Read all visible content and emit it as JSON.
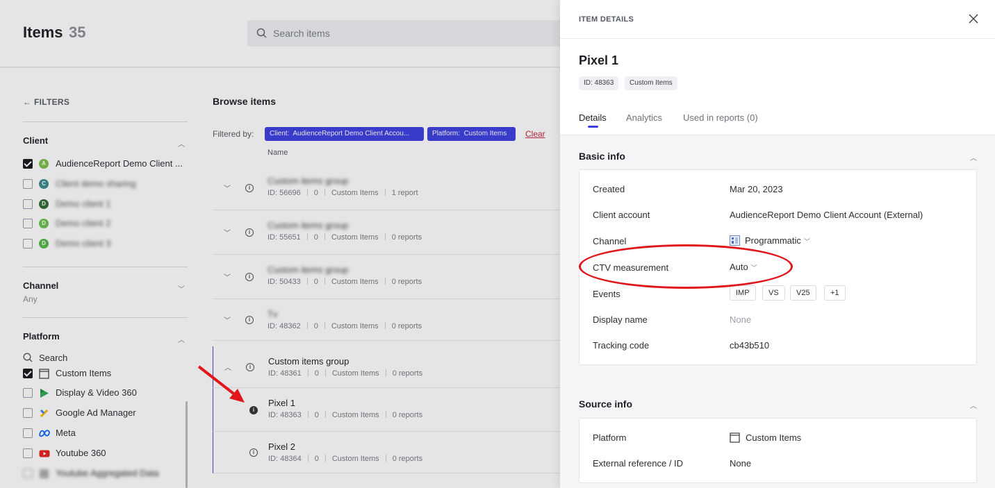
{
  "header": {
    "title": "Items",
    "count": "35",
    "search_placeholder": "Search items"
  },
  "sidebar": {
    "filters_label": "FILTERS",
    "client": {
      "title": "Client",
      "options": [
        {
          "label": "AudienceReport Demo Client ...",
          "avatar": "A",
          "color": "#7cc04a",
          "checked": true
        },
        {
          "label": "Client demo sharing",
          "avatar": "C",
          "color": "#3a8a8c",
          "checked": false
        },
        {
          "label": "Demo client 1",
          "avatar": "D",
          "color": "#2f6d2f",
          "checked": false
        },
        {
          "label": "Demo client 2",
          "avatar": "D",
          "color": "#6ac24a",
          "checked": false
        },
        {
          "label": "Demo client 3",
          "avatar": "D",
          "color": "#55b947",
          "checked": false
        }
      ]
    },
    "channel": {
      "title": "Channel",
      "value": "Any"
    },
    "platform": {
      "title": "Platform",
      "search_placeholder": "Search",
      "options": [
        {
          "label": "Custom Items",
          "icon": "custom-items-icon",
          "checked": true
        },
        {
          "label": "Display & Video 360",
          "icon": "dv360-icon",
          "checked": false
        },
        {
          "label": "Google Ad Manager",
          "icon": "google-ad-manager-icon",
          "checked": false
        },
        {
          "label": "Meta",
          "icon": "meta-icon",
          "checked": false
        },
        {
          "label": "Youtube 360",
          "icon": "youtube-icon",
          "checked": false
        },
        {
          "label": "Youtube Aggregated Data",
          "icon": "youtube-aggregated-icon",
          "checked": false
        }
      ]
    }
  },
  "main": {
    "title": "Browse items",
    "filtered_by_label": "Filtered by:",
    "chips": [
      {
        "key": "Client:",
        "value": "AudienceReport Demo Client Accou..."
      },
      {
        "key": "Platform:",
        "value": "Custom Items"
      }
    ],
    "clear_label": "Clear",
    "column_name": "Name",
    "rows": [
      {
        "name": "Custom items group",
        "id": "ID: 56696",
        "count": "0",
        "type": "Custom Items",
        "reports": "1 report",
        "blurred": true
      },
      {
        "name": "Custom items group",
        "id": "ID: 55651",
        "count": "0",
        "type": "Custom Items",
        "reports": "0 reports",
        "blurred": true
      },
      {
        "name": "Custom items group",
        "id": "ID: 50433",
        "count": "0",
        "type": "Custom Items",
        "reports": "0 reports",
        "blurred": true
      },
      {
        "name": "Tv",
        "id": "ID: 48362",
        "count": "0",
        "type": "Custom Items",
        "reports": "0 reports",
        "blurred": true
      },
      {
        "name": "Custom items group",
        "id": "ID: 48361",
        "count": "0",
        "type": "Custom Items",
        "reports": "0 reports",
        "blurred": false
      },
      {
        "name": "Pixel 1",
        "id": "ID: 48363",
        "count": "0",
        "type": "Custom Items",
        "reports": "0 reports",
        "blurred": false
      },
      {
        "name": "Pixel 2",
        "id": "ID: 48364",
        "count": "0",
        "type": "Custom Items",
        "reports": "0 reports",
        "blurred": false
      }
    ]
  },
  "panel": {
    "title": "ITEM DETAILS",
    "item_name": "Pixel 1",
    "tags": [
      "ID: 48363",
      "Custom Items"
    ],
    "tabs": [
      "Details",
      "Analytics",
      "Used in reports (0)"
    ],
    "basic_info": {
      "title": "Basic info",
      "fields": {
        "created_label": "Created",
        "created_value": "Mar 20, 2023",
        "client_label": "Client account",
        "client_value": "AudienceReport Demo Client Account (External)",
        "channel_label": "Channel",
        "channel_value": "Programmatic",
        "ctv_label": "CTV measurement",
        "ctv_value": "Auto",
        "events_label": "Events",
        "events": [
          "IMP",
          "VS",
          "V25",
          "+1"
        ],
        "display_label": "Display name",
        "display_value": "None",
        "tracking_label": "Tracking code",
        "tracking_value": "cb43b510"
      }
    },
    "source_info": {
      "title": "Source info",
      "platform_label": "Platform",
      "platform_value": "Custom Items",
      "extref_label": "External reference / ID",
      "extref_value": "None"
    }
  },
  "annotation_color": "#e0161b",
  "accent_color": "#3c3ee0"
}
